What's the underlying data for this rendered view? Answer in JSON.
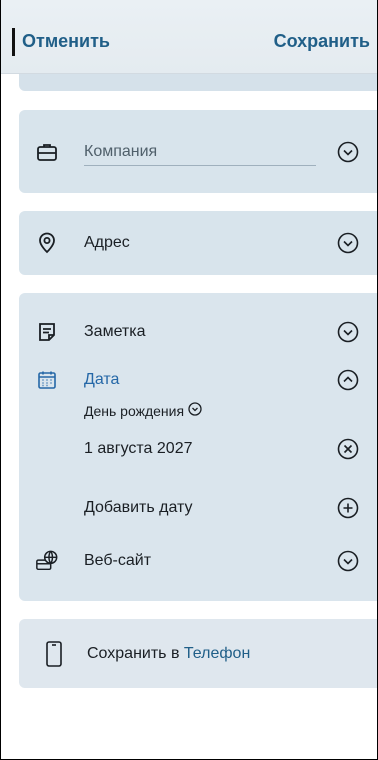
{
  "header": {
    "cancel_label": "Отменить",
    "save_label": "Сохранить"
  },
  "company": {
    "placeholder": "Компания",
    "icon": "briefcase-icon"
  },
  "address": {
    "label": "Адрес",
    "icon": "map-pin-icon"
  },
  "notes_section": {
    "note_label": "Заметка",
    "date_label": "Дата",
    "date_type": "День рождения",
    "date_value": "1 августа 2027",
    "add_date_label": "Добавить дату",
    "website_label": "Веб-сайт"
  },
  "save_to": {
    "prefix": "Сохранить в",
    "target": "Телефон"
  },
  "colors": {
    "accent": "#205f88",
    "date_accent": "#2467a7",
    "card_bg": "#d8e4ec"
  }
}
